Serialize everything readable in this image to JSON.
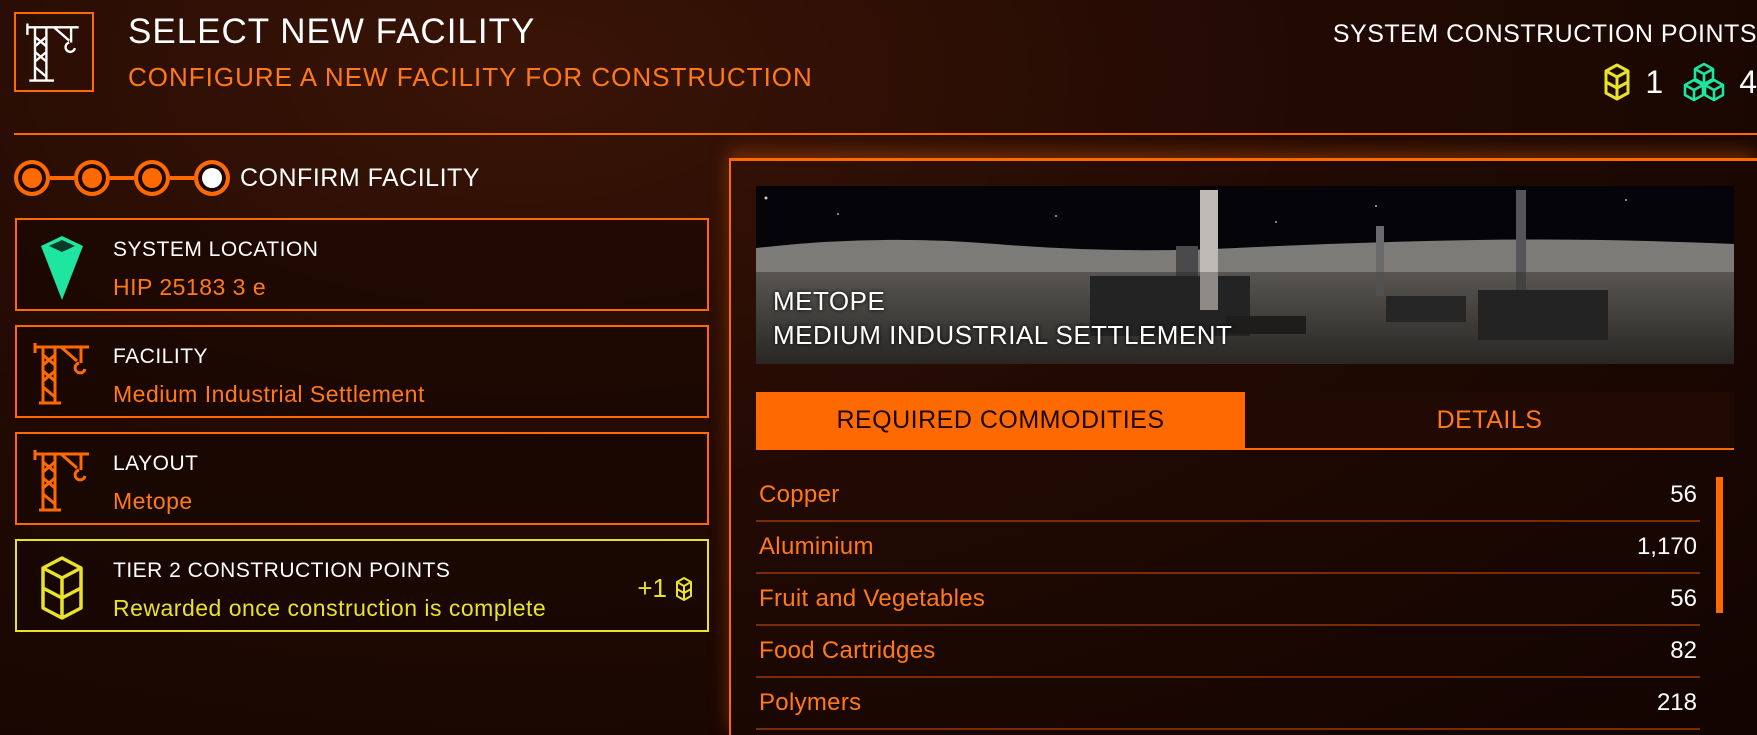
{
  "header": {
    "title": "SELECT NEW FACILITY",
    "subtitle": "CONFIGURE A NEW FACILITY FOR CONSTRUCTION",
    "icon": "crane-icon",
    "points_title": "SYSTEM CONSTRUCTION POINTS",
    "tier2_points": "1",
    "tier3_points": "4"
  },
  "steps": {
    "count": 4,
    "active_index": 3,
    "label": "CONFIRM FACILITY"
  },
  "cards": {
    "location": {
      "title": "SYSTEM LOCATION",
      "value": "HIP 25183 3 e",
      "icon": "location-marker-icon"
    },
    "facility": {
      "title": "FACILITY",
      "value": "Medium Industrial Settlement",
      "icon": "crane-icon"
    },
    "layout": {
      "title": "LAYOUT",
      "value": "Metope",
      "icon": "crane-icon"
    },
    "tier": {
      "title": "TIER 2 CONSTRUCTION POINTS",
      "value": "Rewarded once construction is complete",
      "amount": "+1",
      "icon": "tier2-cube-icon"
    }
  },
  "banner": {
    "name": "METOPE",
    "type": "MEDIUM INDUSTRIAL SETTLEMENT"
  },
  "tabs": {
    "required": "REQUIRED COMMODITIES",
    "details": "DETAILS",
    "selected": "required"
  },
  "commodities": [
    {
      "name": "Copper",
      "qty": "56"
    },
    {
      "name": "Aluminium",
      "qty": "1,170"
    },
    {
      "name": "Fruit and Vegetables",
      "qty": "56"
    },
    {
      "name": "Food Cartridges",
      "qty": "82"
    },
    {
      "name": "Polymers",
      "qty": "218"
    }
  ],
  "colors": {
    "accent": "#ff6a00",
    "tier2": "#e8e22c",
    "tier3": "#1ee6a0",
    "location": "#1ee6a0"
  }
}
